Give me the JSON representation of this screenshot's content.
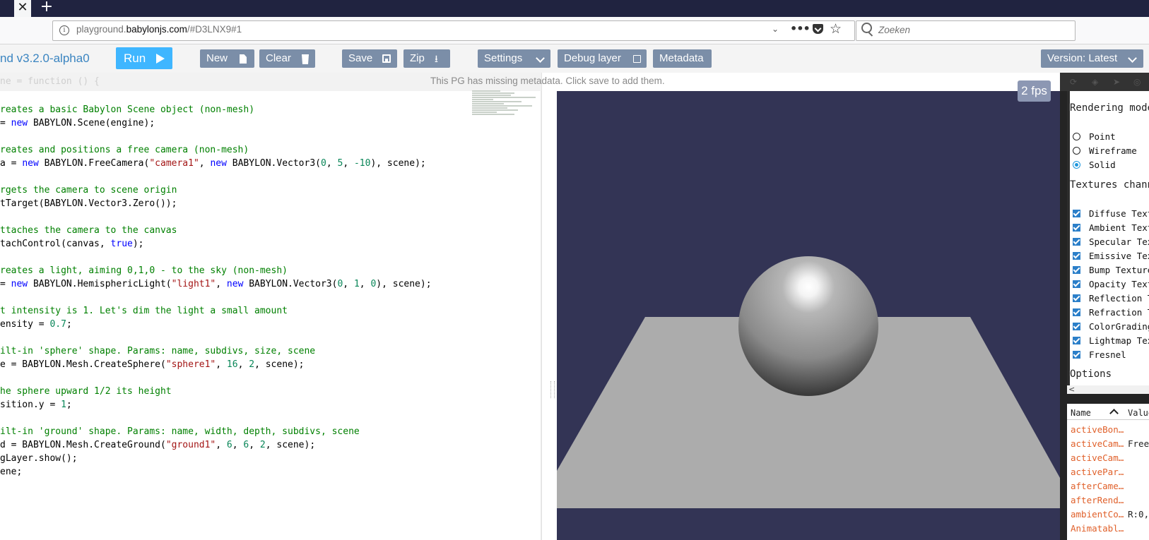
{
  "browser": {
    "tab_close": "✕",
    "tab_new": "+",
    "url_prefix": "playground.",
    "url_host": "babylonjs.com",
    "url_suffix": "/#D3LNX9#1",
    "search_placeholder": "Zoeken"
  },
  "app": {
    "title": "nd v3.2.0-alpha0",
    "accent": "#3fb6ff",
    "button_color": "#7b8ea8"
  },
  "toolbar": {
    "run": "Run",
    "new": "New",
    "clear": "Clear",
    "save": "Save",
    "zip": "Zip",
    "settings": "Settings",
    "debug_layer": "Debug layer",
    "metadata": "Metadata",
    "version": "Version: Latest"
  },
  "editor": {
    "header_code": "ne = function () {",
    "metadata_notice": "This PG has missing metadata. Click save to add them.",
    "lines": [
      [
        [
          "cm",
          "reates a basic Babylon Scene object (non-mesh)"
        ]
      ],
      [
        [
          "",
          "= "
        ],
        [
          "kw",
          "new"
        ],
        [
          "",
          " BABYLON.Scene(engine);"
        ]
      ],
      [],
      [
        [
          "cm",
          "reates and positions a free camera (non-mesh)"
        ]
      ],
      [
        [
          "",
          "a = "
        ],
        [
          "kw",
          "new"
        ],
        [
          "",
          " BABYLON.FreeCamera("
        ],
        [
          "str",
          "\"camera1\""
        ],
        [
          "",
          ", "
        ],
        [
          "kw",
          "new"
        ],
        [
          "",
          " BABYLON.Vector3("
        ],
        [
          "num",
          "0"
        ],
        [
          "",
          ", "
        ],
        [
          "num",
          "5"
        ],
        [
          "",
          ", "
        ],
        [
          "num",
          "-10"
        ],
        [
          "",
          "), scene);"
        ]
      ],
      [],
      [
        [
          "cm",
          "rgets the camera to scene origin"
        ]
      ],
      [
        [
          "",
          "tTarget(BABYLON.Vector3.Zero());"
        ]
      ],
      [],
      [
        [
          "cm",
          "ttaches the camera to the canvas"
        ]
      ],
      [
        [
          "",
          "tachControl(canvas, "
        ],
        [
          "kw",
          "true"
        ],
        [
          "",
          ");"
        ]
      ],
      [],
      [
        [
          "cm",
          "reates a light, aiming 0,1,0 - to the sky (non-mesh)"
        ]
      ],
      [
        [
          "",
          "= "
        ],
        [
          "kw",
          "new"
        ],
        [
          "",
          " BABYLON.HemisphericLight("
        ],
        [
          "str",
          "\"light1\""
        ],
        [
          "",
          ", "
        ],
        [
          "kw",
          "new"
        ],
        [
          "",
          " BABYLON.Vector3("
        ],
        [
          "num",
          "0"
        ],
        [
          "",
          ", "
        ],
        [
          "num",
          "1"
        ],
        [
          "",
          ", "
        ],
        [
          "num",
          "0"
        ],
        [
          "",
          "), scene);"
        ]
      ],
      [],
      [
        [
          "cm",
          "t intensity is 1. Let's dim the light a small amount"
        ]
      ],
      [
        [
          "",
          "ensity = "
        ],
        [
          "num",
          "0.7"
        ],
        [
          "",
          ";"
        ]
      ],
      [],
      [
        [
          "cm",
          "ilt-in 'sphere' shape. Params: name, subdivs, size, scene"
        ]
      ],
      [
        [
          "",
          "e = BABYLON.Mesh.CreateSphere("
        ],
        [
          "str",
          "\"sphere1\""
        ],
        [
          "",
          ", "
        ],
        [
          "num",
          "16"
        ],
        [
          "",
          ", "
        ],
        [
          "num",
          "2"
        ],
        [
          "",
          ", scene);"
        ]
      ],
      [],
      [
        [
          "cm",
          "he sphere upward 1/2 its height"
        ]
      ],
      [
        [
          "",
          "sition.y = "
        ],
        [
          "num",
          "1"
        ],
        [
          "",
          ";"
        ]
      ],
      [],
      [
        [
          "cm",
          "ilt-in 'ground' shape. Params: name, width, depth, subdivs, scene"
        ]
      ],
      [
        [
          "",
          "d = BABYLON.Mesh.CreateGround("
        ],
        [
          "str",
          "\"ground1\""
        ],
        [
          "",
          ", "
        ],
        [
          "num",
          "6"
        ],
        [
          "",
          ", "
        ],
        [
          "num",
          "6"
        ],
        [
          "",
          ", "
        ],
        [
          "num",
          "2"
        ],
        [
          "",
          ", scene);"
        ]
      ],
      [
        [
          "",
          "gLayer.show();"
        ]
      ],
      [
        [
          "",
          "ene;"
        ]
      ]
    ]
  },
  "viewport": {
    "fps": "2 fps",
    "background": "#333455"
  },
  "debug": {
    "rendering_mode": "Rendering mode",
    "modes": [
      "Point",
      "Wireframe",
      "Solid"
    ],
    "selected_mode": "Solid",
    "textures_channels": "Textures channels",
    "channels": [
      "Diffuse Texture",
      "Ambient Texture",
      "Specular Texture",
      "Emissive Texture",
      "Bump Texture",
      "Opacity Texture",
      "Reflection Texture",
      "Refraction Texture",
      "ColorGrading",
      "Lightmap Texture",
      "Fresnel"
    ],
    "options": "Options",
    "props_header": [
      "Name",
      "Value"
    ],
    "props": [
      {
        "name": "activeBon…",
        "value": ""
      },
      {
        "name": "activeCam…",
        "value": "Free"
      },
      {
        "name": "activeCam…",
        "value": ""
      },
      {
        "name": "activePar…",
        "value": ""
      },
      {
        "name": "afterCame…",
        "value": ""
      },
      {
        "name": "afterRend…",
        "value": ""
      },
      {
        "name": "ambientCo…",
        "value": "R:0,"
      },
      {
        "name": "Animatabl…",
        "value": ""
      }
    ]
  }
}
